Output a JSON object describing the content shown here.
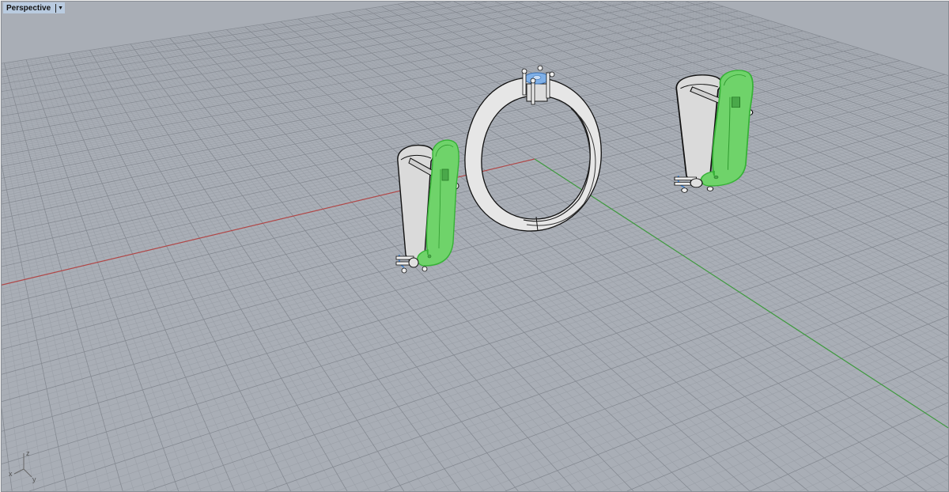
{
  "viewport": {
    "title": "Perspective",
    "dropdown_icon": "triangle-down-icon"
  },
  "axis_widget": {
    "x": "x",
    "y": "y",
    "z": "z"
  },
  "colors": {
    "background": "#a9aeb6",
    "grid_minor": "#9ba0a8",
    "grid_major": "#858a92",
    "x_axis": "#b04848",
    "y_axis": "#3f9a3f",
    "selected": "#6fd36a",
    "gem": "#7fb0e8"
  }
}
